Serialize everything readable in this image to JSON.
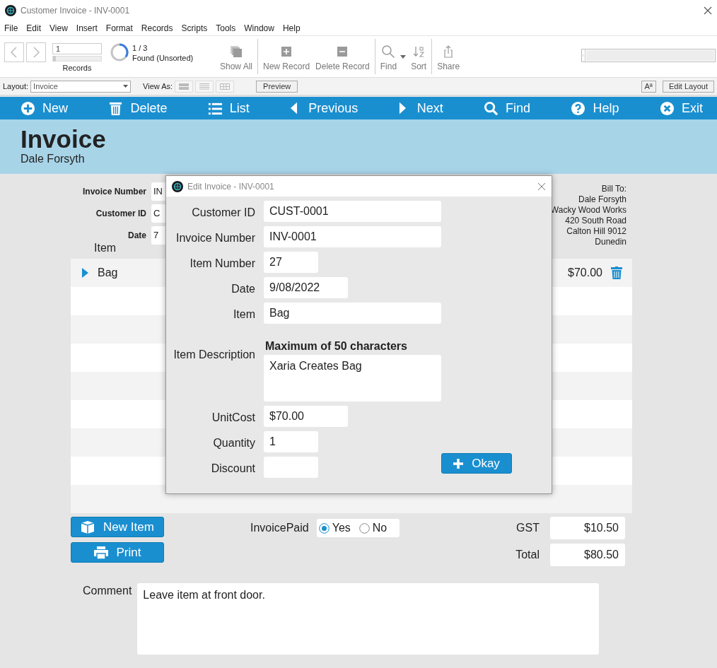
{
  "window": {
    "title": "Customer Invoice - INV-0001"
  },
  "menu": [
    "File",
    "Edit",
    "View",
    "Insert",
    "Format",
    "Records",
    "Scripts",
    "Tools",
    "Window",
    "Help"
  ],
  "toolbar": {
    "record_number": "1",
    "records_label": "Records",
    "record_slider": {
      "level": 0
    },
    "found_count": "1 / 3",
    "found_status": "Found (Unsorted)",
    "buttons": [
      {
        "label": "Show All",
        "kind": "showall"
      },
      {
        "label": "New Record",
        "kind": "new"
      },
      {
        "label": "Delete Record",
        "kind": "delete"
      },
      {
        "label": "Find",
        "kind": "find"
      },
      {
        "label": "Sort",
        "kind": "sort"
      },
      {
        "label": "Share",
        "kind": "share"
      }
    ]
  },
  "layout_bar": {
    "layout_label": "Layout:",
    "layout_value": "Invoice",
    "view_as_label": "View As:",
    "preview": "Preview",
    "text_size": "Aª",
    "edit_layout": "Edit Layout"
  },
  "nav": [
    {
      "label": "New",
      "kind": "new"
    },
    {
      "label": "Delete",
      "kind": "delete"
    },
    {
      "label": "List",
      "kind": "list"
    },
    {
      "label": "Previous",
      "kind": "previous"
    },
    {
      "label": "Next",
      "kind": "next"
    },
    {
      "label": "Find",
      "kind": "find"
    },
    {
      "label": "Help",
      "kind": "help"
    },
    {
      "label": "Exit",
      "kind": "exit"
    }
  ],
  "header": {
    "title": "Invoice",
    "subtitle": "Dale Forsyth"
  },
  "form_fields": [
    {
      "label": "Invoice Number",
      "value": "IN"
    },
    {
      "label": "Customer ID",
      "value": "C"
    },
    {
      "label": "Date",
      "value": "7"
    }
  ],
  "bill_to": [
    "Bill To:",
    "Dale  Forsyth",
    "Wacky Wood Works",
    "420 South Road",
    "Calton Hill 9012",
    "Dunedin"
  ],
  "items": {
    "column_header": "Item",
    "rows": [
      {
        "item": "Bag",
        "amount": "$70.00"
      }
    ]
  },
  "new_item_button": "New Item",
  "print_button": "Print",
  "invoice_paid": {
    "label": "InvoicePaid",
    "options": [
      {
        "label": "Yes",
        "selected": true
      },
      {
        "label": "No",
        "selected": false
      }
    ]
  },
  "gst": {
    "label": "GST",
    "value": "$10.50"
  },
  "total": {
    "label": "Total",
    "value": "$80.50"
  },
  "comment": {
    "label": "Comment",
    "value": "Leave item at front door."
  },
  "dialog": {
    "title": "Edit Invoice - INV-0001",
    "fields": [
      {
        "label": "Customer ID",
        "value": "CUST-0001",
        "kind": "long"
      },
      {
        "label": "Invoice Number",
        "value": "INV-0001",
        "kind": "long"
      },
      {
        "label": "Item Number",
        "value": "27",
        "kind": "short"
      },
      {
        "label": "Date",
        "value": "9/08/2022",
        "kind": "medium"
      },
      {
        "label": "Item",
        "value": "Bag",
        "kind": "long"
      },
      {
        "label": "Item Description",
        "value": "Xaria Creates Bag",
        "kind": "multiline",
        "hint": "Maximum of 50 characters"
      },
      {
        "label": "UnitCost",
        "value": "$70.00",
        "kind": "medium"
      },
      {
        "label": "Quantity",
        "value": "1",
        "kind": "short"
      },
      {
        "label": "Discount",
        "kind": "short"
      }
    ],
    "okay_button": "Okay"
  }
}
